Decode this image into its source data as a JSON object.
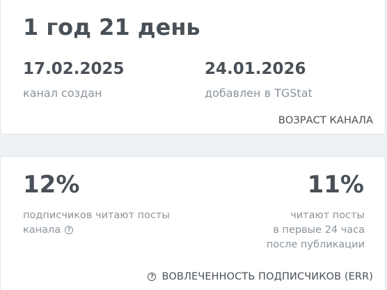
{
  "age_card": {
    "age_value": "1 год 21 день",
    "created_date": "17.02.2025",
    "created_label": "канал создан",
    "added_date": "24.01.2026",
    "added_label": "добавлен в TGStat",
    "title": "ВОЗРАСТ КАНАЛА"
  },
  "err_card": {
    "left_value": "12%",
    "left_label_line1": "подписчиков читают посты",
    "left_label_line2": "канала",
    "right_value": "11%",
    "right_label_line1": "читают посты",
    "right_label_line2": "в первые 24 часа",
    "right_label_line3": "после публикации",
    "title": "ВОВЛЕЧЕННОСТЬ ПОДПИСЧИКОВ (ERR)",
    "help_icon": "question-circle-icon"
  }
}
